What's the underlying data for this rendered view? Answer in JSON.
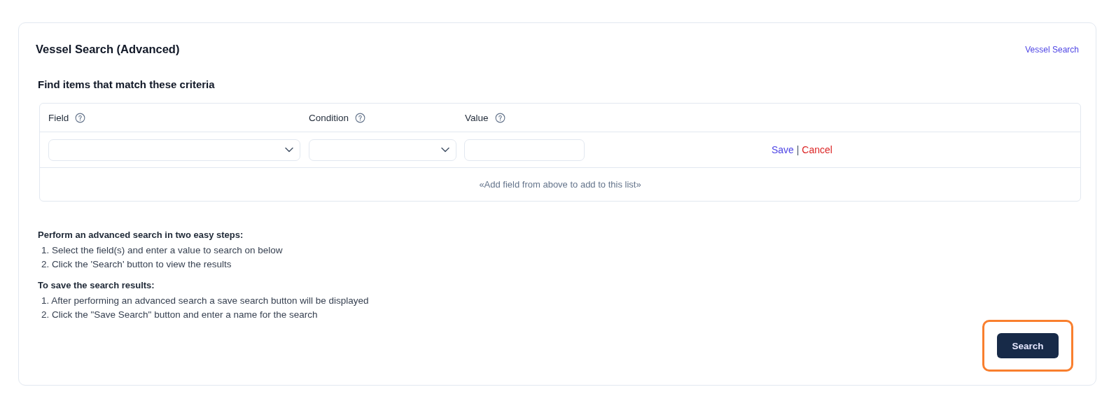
{
  "page": {
    "title": "Vessel Search (Advanced)",
    "link": "Vessel Search"
  },
  "criteria": {
    "heading": "Find items that match these criteria",
    "columns": [
      {
        "label": "Field",
        "kind": "select"
      },
      {
        "label": "Condition",
        "kind": "select"
      },
      {
        "label": "Value",
        "kind": "text"
      }
    ],
    "actions": {
      "save": "Save",
      "separator": "|",
      "cancel": "Cancel"
    },
    "hint": "«Add field from above to add to this list»"
  },
  "instructions": [
    {
      "heading": "Perform an advanced search in two easy steps:",
      "steps": [
        "1. Select the field(s) and enter a value to search on below",
        "2. Click the 'Search' button to view the results"
      ]
    },
    {
      "heading": "To save the search results:",
      "steps": [
        "1. After performing an advanced search a save search button will be displayed",
        "2. Click the \"Save Search\" button and enter a name for the search"
      ]
    }
  ],
  "search_button": {
    "label": "Search",
    "highlighted": true
  }
}
